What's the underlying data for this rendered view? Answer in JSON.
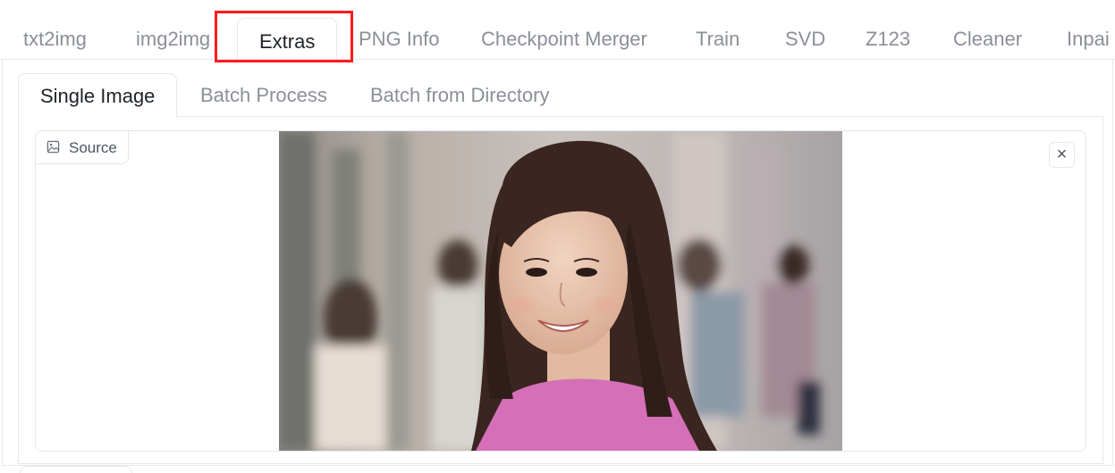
{
  "top_tabs": [
    {
      "label": "txt2img"
    },
    {
      "label": "img2img"
    },
    {
      "label": "Extras"
    },
    {
      "label": "PNG Info"
    },
    {
      "label": "Checkpoint Merger"
    },
    {
      "label": "Train"
    },
    {
      "label": "SVD"
    },
    {
      "label": "Z123"
    },
    {
      "label": "Cleaner"
    },
    {
      "label": "Inpai"
    }
  ],
  "active_top_tab": "Extras",
  "sub_tabs": [
    {
      "label": "Single Image"
    },
    {
      "label": "Batch Process"
    },
    {
      "label": "Batch from Directory"
    }
  ],
  "active_sub_tab": "Single Image",
  "image_input": {
    "label": "Source",
    "label_icon": "image-icon",
    "close_icon": "close-icon",
    "close_glyph": "×"
  },
  "highlight_color": "#ff1a1a"
}
